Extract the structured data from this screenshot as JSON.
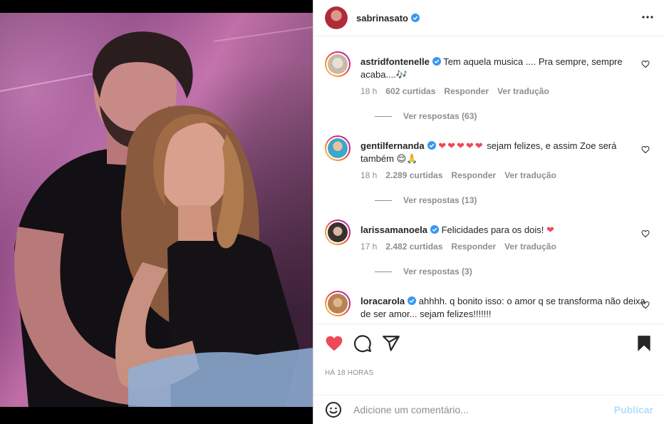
{
  "post": {
    "author": "sabrinasato",
    "timestamp": "HÁ 18 HORAS"
  },
  "comments": [
    {
      "username": "astridfontenelle",
      "text": "Tem aquela musica .... Pra sempre, sempre acaba....",
      "emoji": "🎶",
      "time": "18 h",
      "likes": "602 curtidas",
      "reply_label": "Responder",
      "translate_label": "Ver tradução",
      "view_replies": "Ver respostas (63)"
    },
    {
      "username": "gentilfernanda",
      "text": "sejam felizes, e assim Zoe será também",
      "hearts": "❤❤❤❤❤",
      "emoji": "😌🙏",
      "time": "18 h",
      "likes": "2.289 curtidas",
      "reply_label": "Responder",
      "translate_label": "Ver tradução",
      "view_replies": "Ver respostas (13)"
    },
    {
      "username": "larissamanoela",
      "text": "Felicidades para os dois!",
      "emoji": "❤",
      "time": "17 h",
      "likes": "2.482 curtidas",
      "reply_label": "Responder",
      "translate_label": "Ver tradução",
      "view_replies": "Ver respostas (3)"
    },
    {
      "username": "loracarola",
      "text": "ahhhh. q bonito isso: o amor q se transforma não deixa de ser amor... sejam felizes!!!!!!!"
    }
  ],
  "composer": {
    "placeholder": "Adicione um comentário...",
    "publish_label": "Publicar"
  },
  "colors": {
    "like_red": "#ed4956",
    "verified_blue": "#3897f0",
    "muted": "#8e8e8e",
    "publish_disabled": "#b2dffc"
  }
}
